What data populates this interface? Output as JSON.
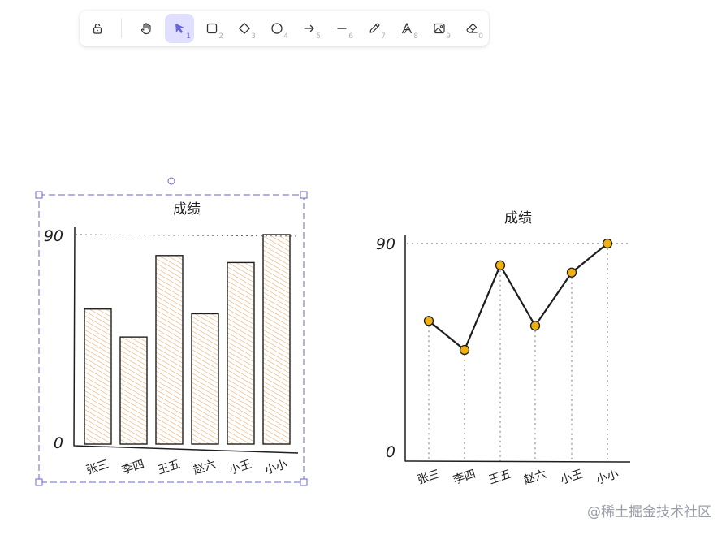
{
  "toolbar": {
    "tools": [
      {
        "name": "lock",
        "key": ""
      },
      {
        "name": "hand",
        "key": ""
      },
      {
        "name": "selection",
        "key": "1"
      },
      {
        "name": "rectangle",
        "key": "2"
      },
      {
        "name": "diamond",
        "key": "3"
      },
      {
        "name": "ellipse",
        "key": "4"
      },
      {
        "name": "arrow",
        "key": "5"
      },
      {
        "name": "line",
        "key": "6"
      },
      {
        "name": "draw",
        "key": "7"
      },
      {
        "name": "text",
        "key": "8"
      },
      {
        "name": "image",
        "key": "9"
      },
      {
        "name": "eraser",
        "key": "0"
      }
    ],
    "active_tool": "selection"
  },
  "chart_data": [
    {
      "type": "bar",
      "title": "成绩",
      "categories": [
        "张三",
        "李四",
        "王五",
        "赵六",
        "小王",
        "小小"
      ],
      "values": [
        58,
        46,
        81,
        56,
        78,
        90
      ],
      "ylim": [
        0,
        90
      ],
      "ytick_labels": [
        "0",
        "90"
      ],
      "selected": true,
      "fill_color": "#f4c791",
      "stroke_color": "#1e1e1e"
    },
    {
      "type": "line",
      "title": "成绩",
      "categories": [
        "张三",
        "李四",
        "王五",
        "赵六",
        "小王",
        "小小"
      ],
      "values": [
        58,
        46,
        81,
        56,
        78,
        90
      ],
      "ylim": [
        0,
        90
      ],
      "ytick_labels": [
        "0",
        "90"
      ],
      "point_color": "#f0b110",
      "stroke_color": "#1e1e1e"
    }
  ],
  "watermark": "@稀土掘金技术社区",
  "colors": {
    "selection": "#6965db",
    "active_tool_bg": "#e0dfff"
  }
}
